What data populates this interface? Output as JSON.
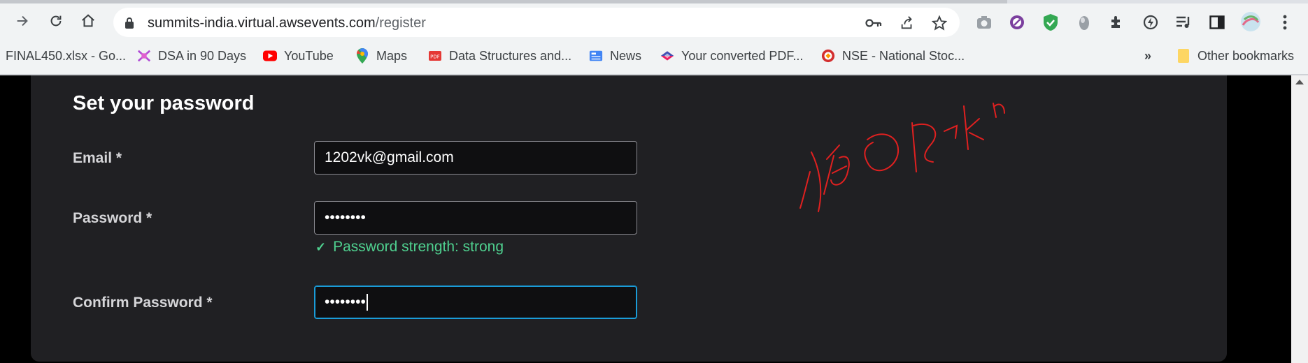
{
  "browser": {
    "url_host": "summits-india.virtual.awsevents.com",
    "url_path": "/register",
    "bookmarks": [
      {
        "label": "FINAL450.xlsx - Go...",
        "icon": "spreadsheet-icon"
      },
      {
        "label": "DSA in 90 Days",
        "icon": "dsa-icon"
      },
      {
        "label": "YouTube",
        "icon": "youtube-icon"
      },
      {
        "label": "Maps",
        "icon": "maps-icon"
      },
      {
        "label": "Data Structures and...",
        "icon": "pdf-icon"
      },
      {
        "label": "News",
        "icon": "news-icon"
      },
      {
        "label": "Your converted PDF...",
        "icon": "diamond-icon"
      },
      {
        "label": "NSE - National Stoc...",
        "icon": "nse-icon"
      }
    ],
    "overflow_label": "»",
    "other_bookmarks": "Other bookmarks",
    "colors": {
      "chrome_bg": "#f1f3f4",
      "youtube_red": "#ff0000"
    }
  },
  "form": {
    "title": "Set your password",
    "email_label": "Email *",
    "email_value": "1202vk@gmail.com",
    "password_label": "Password *",
    "password_value": "••••••••",
    "strength_text": "Password strength: strong",
    "confirm_label": "Confirm Password *",
    "confirm_value": "••••••••",
    "colors": {
      "panel_bg": "#202023",
      "strength_green": "#4fd08f",
      "focus_blue": "#1a9cd8"
    }
  },
  "annotation": {
    "color": "#e02020",
    "icon": "handwritten-scribble"
  }
}
